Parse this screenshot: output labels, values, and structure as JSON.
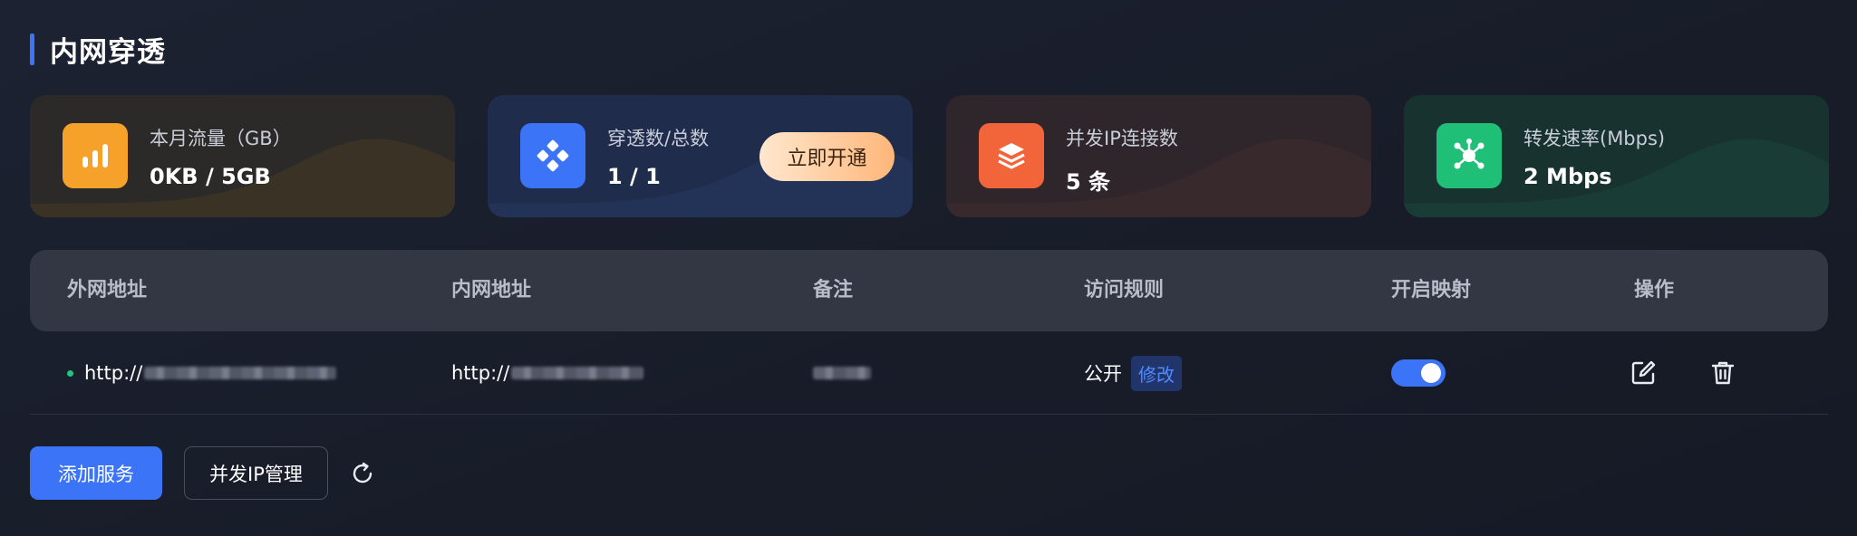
{
  "page_title": "内网穿透",
  "stats": [
    {
      "label": "本月流量（GB）",
      "value": "0KB / 5GB",
      "icon": "bar-chart-icon",
      "color": "#f6a12a"
    },
    {
      "label": "穿透数/总数",
      "value": "1 / 1",
      "icon": "nodes-icon",
      "color": "#3b74f6",
      "action": "立即开通"
    },
    {
      "label": "并发IP连接数",
      "value": "5 条",
      "icon": "layers-icon",
      "color": "#f2653b"
    },
    {
      "label": "转发速率(Mbps)",
      "value": "2 Mbps",
      "icon": "network-icon",
      "color": "#1fbf78"
    }
  ],
  "table": {
    "columns": [
      "外网地址",
      "内网地址",
      "备注",
      "访问规则",
      "开启映射",
      "操作"
    ],
    "rows": [
      {
        "external": "http://",
        "internal": "http://",
        "note": "",
        "rule": "公开",
        "rule_edit": "修改",
        "mapping_enabled": true
      }
    ]
  },
  "buttons": {
    "add_service": "添加服务",
    "concurrent_ip": "并发IP管理"
  },
  "colors": {
    "accent": "#3b74f6",
    "status_online": "#22c47e"
  }
}
